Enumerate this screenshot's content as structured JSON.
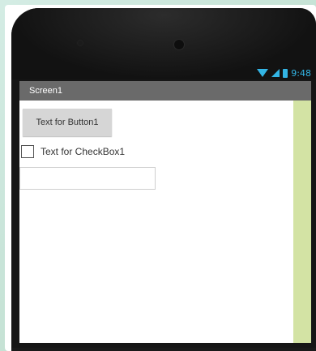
{
  "status_bar": {
    "time": "9:48",
    "icons": [
      "wifi-icon",
      "signal-icon",
      "battery-icon"
    ],
    "accent_color": "#33b5e5"
  },
  "screen": {
    "title": "Screen1",
    "title_bar_color": "#6a6a6a",
    "side_strip_color": "#d3e3a4"
  },
  "components": {
    "button_label": "Text for Button1",
    "checkbox_label": "Text for CheckBox1",
    "checkbox_checked": false,
    "textbox_value": "",
    "textbox_placeholder": ""
  }
}
